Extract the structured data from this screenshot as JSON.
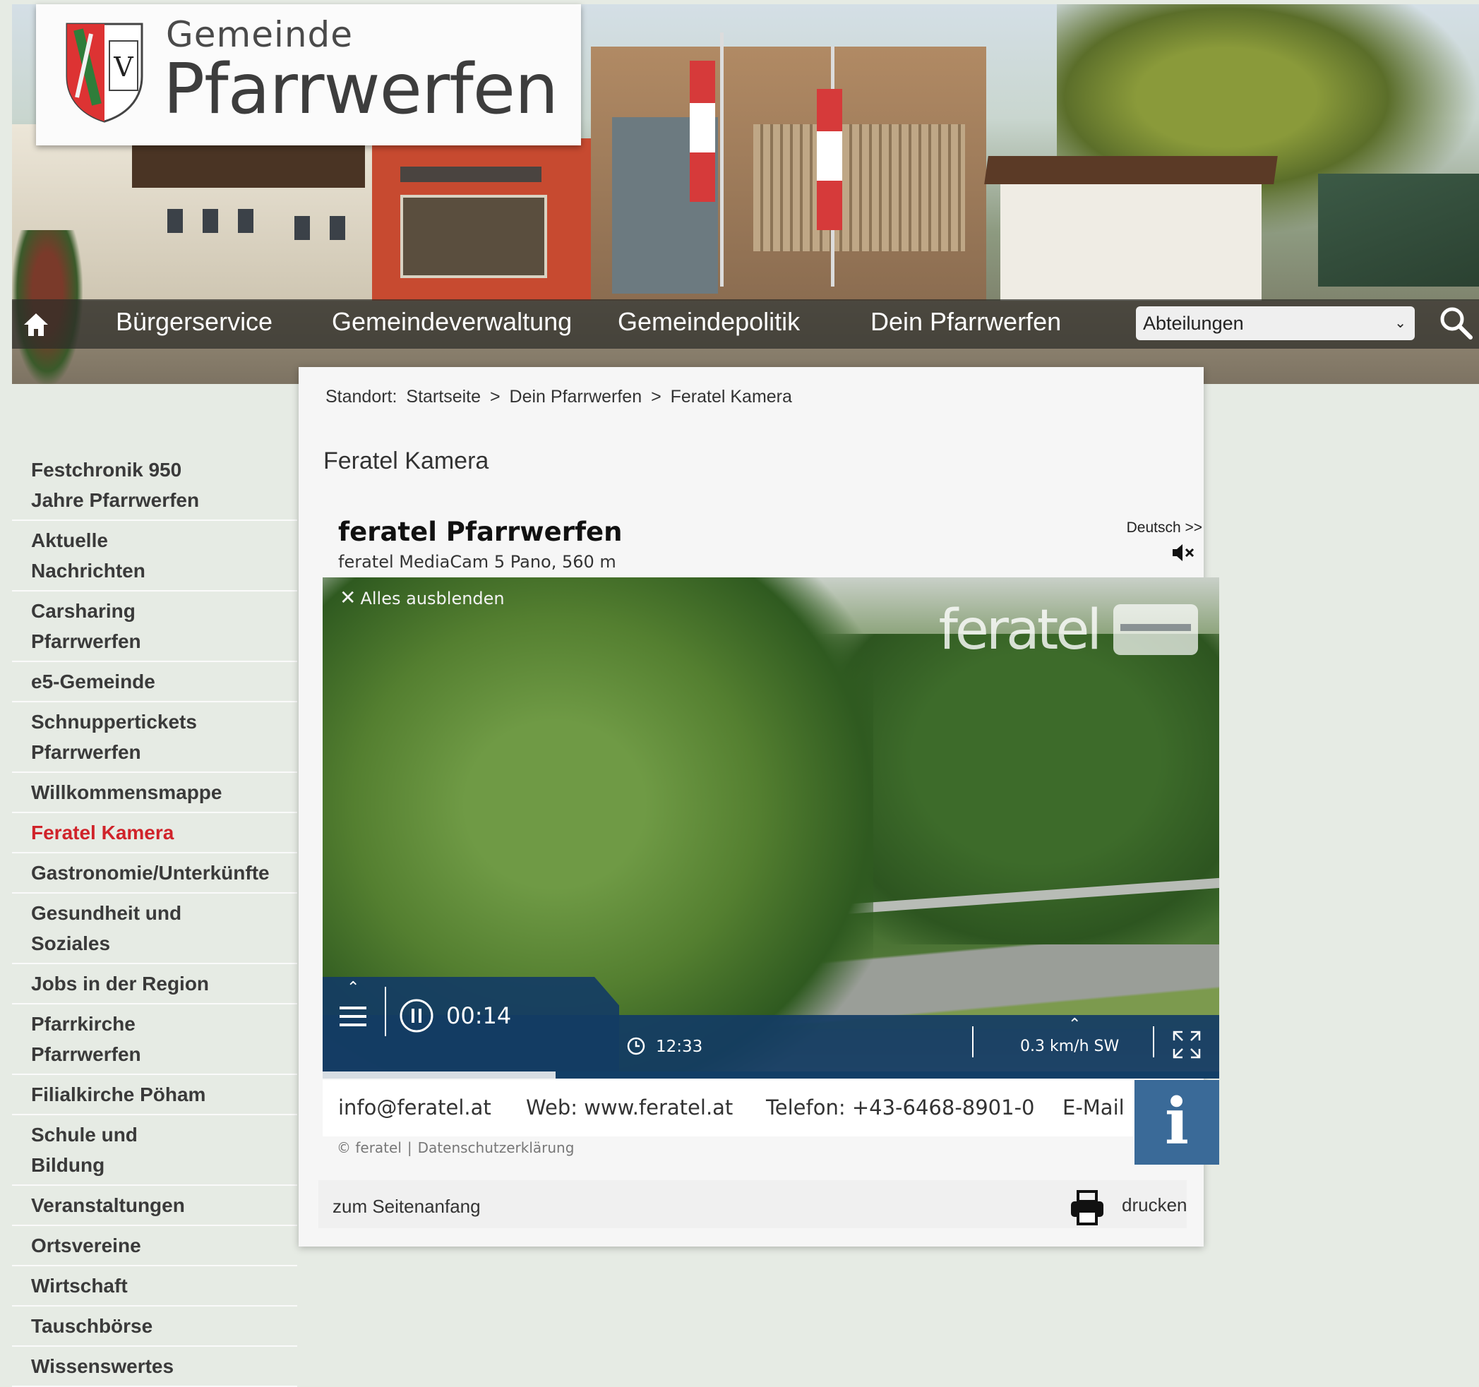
{
  "logo": {
    "line1": "Gemeinde",
    "line2": "Pfarrwerfen"
  },
  "nav": {
    "items": [
      "Bürgerservice",
      "Gemeindeverwaltung",
      "Gemeindepolitik",
      "Dein Pfarrwerfen"
    ],
    "department_select": "Abteilungen"
  },
  "breadcrumb": {
    "prefix": "Standort:",
    "items": [
      "Startseite",
      ">",
      "Dein Pfarrwerfen",
      ">",
      "Feratel Kamera"
    ]
  },
  "page_title": "Feratel Kamera",
  "sidebar": {
    "items": [
      {
        "label": "Festchronik 950 Jahre Pfarrwerfen",
        "active": false
      },
      {
        "label": "Aktuelle Nachrichten",
        "active": false
      },
      {
        "label": "Carsharing Pfarrwerfen",
        "active": false
      },
      {
        "label": "e5-Gemeinde",
        "active": false
      },
      {
        "label": "Schnuppertickets Pfarrwerfen",
        "active": false
      },
      {
        "label": "Willkommensmappe",
        "active": false
      },
      {
        "label": "Feratel Kamera",
        "active": true
      },
      {
        "label": "Gastronomie/Unterkünfte",
        "active": false
      },
      {
        "label": "Gesundheit und Soziales",
        "active": false
      },
      {
        "label": "Jobs in der Region",
        "active": false
      },
      {
        "label": "Pfarrkirche Pfarrwerfen",
        "active": false
      },
      {
        "label": "Filialkirche Pöham",
        "active": false
      },
      {
        "label": "Schule und Bildung",
        "active": false
      },
      {
        "label": "Veranstaltungen",
        "active": false
      },
      {
        "label": "Ortsvereine",
        "active": false
      },
      {
        "label": "Wirtschaft",
        "active": false
      },
      {
        "label": "Tauschbörse",
        "active": false
      },
      {
        "label": "Wissenswertes",
        "active": false
      }
    ],
    "active_color": "#d0232a"
  },
  "widget": {
    "title": "feratel Pfarrwerfen",
    "subtitle": "feratel MediaCam 5 Pano, 560 m",
    "language": "Deutsch >>",
    "hide_all": "Alles ausblenden",
    "brand": "feratel",
    "playback_time": "00:14",
    "clock_time": "12:33",
    "wind": "0.3 km/h SW",
    "progress_fraction": 0.26,
    "contact": {
      "email": "info@feratel.at",
      "web": "Web: www.feratel.at",
      "phone": "Telefon: +43-6468-8901-0",
      "email_label": "E-Mail"
    },
    "info": "i",
    "credits": {
      "copyright": "© feratel",
      "separator": "|",
      "privacy": "Datenschutzerklärung"
    },
    "accent_color": "#1b4f7c"
  },
  "footer": {
    "to_top": "zum Seitenanfang",
    "print": "drucken"
  }
}
